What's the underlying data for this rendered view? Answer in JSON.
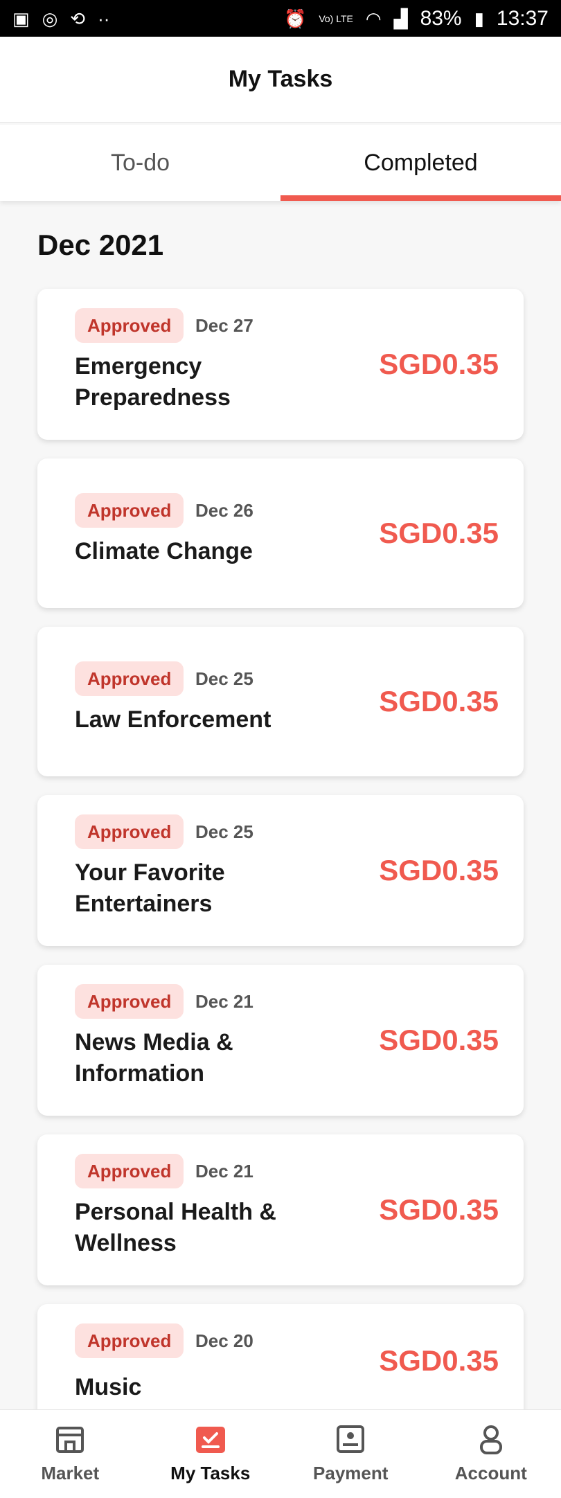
{
  "status_bar": {
    "battery": "83%",
    "time": "13:37",
    "network": "Vo) LTE"
  },
  "header": {
    "title": "My Tasks"
  },
  "tabs": [
    {
      "label": "To-do",
      "active": false
    },
    {
      "label": "Completed",
      "active": true
    }
  ],
  "section": {
    "title": "Dec 2021"
  },
  "tasks": [
    {
      "status": "Approved",
      "date": "Dec 27",
      "title": "Emergency Preparedness",
      "amount": "SGD0.35"
    },
    {
      "status": "Approved",
      "date": "Dec 26",
      "title": "Climate Change",
      "amount": "SGD0.35"
    },
    {
      "status": "Approved",
      "date": "Dec 25",
      "title": "Law Enforcement",
      "amount": "SGD0.35"
    },
    {
      "status": "Approved",
      "date": "Dec 25",
      "title": "Your Favorite Entertainers",
      "amount": "SGD0.35"
    },
    {
      "status": "Approved",
      "date": "Dec 21",
      "title": "News Media & Information",
      "amount": "SGD0.35"
    },
    {
      "status": "Approved",
      "date": "Dec 21",
      "title": "Personal Health & Wellness",
      "amount": "SGD0.35"
    },
    {
      "status": "Approved",
      "date": "Dec 20",
      "title": "Music",
      "amount": "SGD0.35"
    }
  ],
  "bottom_nav": [
    {
      "label": "Market",
      "icon": "market-icon",
      "active": false
    },
    {
      "label": "My Tasks",
      "icon": "tasks-icon",
      "active": true
    },
    {
      "label": "Payment",
      "icon": "payment-icon",
      "active": false
    },
    {
      "label": "Account",
      "icon": "account-icon",
      "active": false
    }
  ],
  "colors": {
    "accent": "#f05a4f",
    "badge_bg": "#fde1df",
    "badge_text": "#c0352b"
  }
}
